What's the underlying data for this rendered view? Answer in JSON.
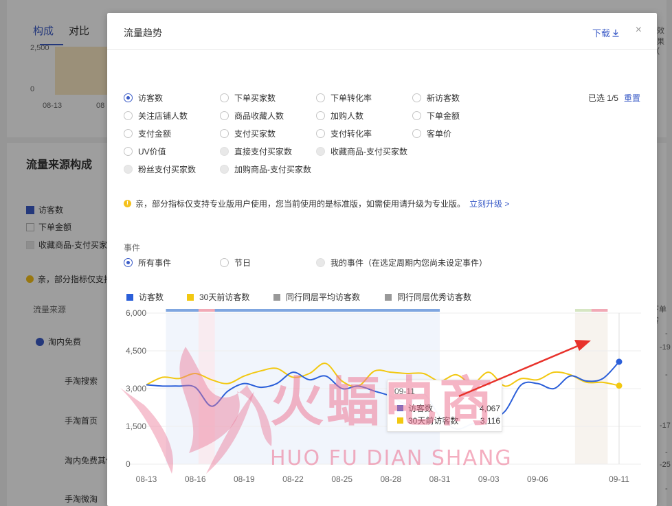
{
  "background": {
    "tabs": [
      "构成",
      "对比"
    ],
    "mini_chart": {
      "y_ticks": [
        "2,500",
        "0"
      ],
      "x_ticks": [
        "08-13",
        "08"
      ]
    },
    "top_right_text": "效果(",
    "section_title": "流量来源构成",
    "checks": [
      {
        "label": "访客数",
        "state": "on"
      },
      {
        "label": "下单金额",
        "state": "off"
      },
      {
        "label": "收藏商品-支付买家",
        "state": "dis"
      }
    ],
    "notice": "亲，部分指标仅支持",
    "table_header": "流量来源",
    "group": "淘内免费",
    "rows": [
      "手淘搜索",
      "手淘首页",
      "淘内免费其他",
      "手淘微淘"
    ],
    "right_header": "下单转",
    "right_values": [
      "-",
      "-19",
      "-",
      "-17",
      "-",
      "-25",
      "-"
    ]
  },
  "modal": {
    "title": "流量趋势",
    "download": "下载",
    "close": "×",
    "selected": "已选 1/5",
    "reset": "重置",
    "metrics": [
      [
        {
          "label": "访客数",
          "state": "checked"
        },
        {
          "label": "下单买家数",
          "state": "normal"
        },
        {
          "label": "下单转化率",
          "state": "normal"
        },
        {
          "label": "新访客数",
          "state": "normal"
        }
      ],
      [
        {
          "label": "关注店铺人数",
          "state": "normal"
        },
        {
          "label": "商品收藏人数",
          "state": "normal"
        },
        {
          "label": "加购人数",
          "state": "normal"
        },
        {
          "label": "下单金额",
          "state": "normal"
        }
      ],
      [
        {
          "label": "支付金额",
          "state": "normal"
        },
        {
          "label": "支付买家数",
          "state": "normal"
        },
        {
          "label": "支付转化率",
          "state": "normal"
        },
        {
          "label": "客单价",
          "state": "normal"
        }
      ],
      [
        {
          "label": "UV价值",
          "state": "normal"
        },
        {
          "label": "直接支付买家数",
          "state": "disabled"
        },
        {
          "label": "收藏商品-支付买家数",
          "state": "disabled"
        }
      ],
      [
        {
          "label": "粉丝支付买家数",
          "state": "disabled"
        },
        {
          "label": "加购商品-支付买家数",
          "state": "disabled"
        }
      ]
    ],
    "notice": {
      "text": "亲，部分指标仅支持专业版用户使用，您当前使用的是标准版，如需使用请升级为专业版。",
      "link": "立刻升级 >"
    },
    "event_label": "事件",
    "events": [
      {
        "label": "所有事件",
        "state": "checked"
      },
      {
        "label": "节日",
        "state": "normal"
      },
      {
        "label": "我的事件（在选定周期内您尚未设定事件）",
        "state": "disabled"
      }
    ],
    "legend": [
      {
        "label": "访客数",
        "color": "#2b5fd9"
      },
      {
        "label": "30天前访客数",
        "color": "#f2c811"
      },
      {
        "label": "同行同层平均访客数",
        "color": "#999999"
      },
      {
        "label": "同行同层优秀访客数",
        "color": "#999999"
      }
    ],
    "tooltip": {
      "date": "09-11",
      "rows": [
        {
          "name": "访客数",
          "value": "4,067",
          "color": "#2b5fd9"
        },
        {
          "name": "30天前访客数",
          "value": "3,116",
          "color": "#f2c811"
        }
      ]
    }
  },
  "chart_data": {
    "type": "line",
    "x": [
      "08-13",
      "08-14",
      "08-15",
      "08-16",
      "08-17",
      "08-18",
      "08-19",
      "08-20",
      "08-21",
      "08-22",
      "08-23",
      "08-24",
      "08-25",
      "08-26",
      "08-27",
      "08-28",
      "08-29",
      "08-30",
      "08-31",
      "09-01",
      "09-02",
      "09-03",
      "09-04",
      "09-05",
      "09-06",
      "09-07",
      "09-08",
      "09-09",
      "09-10",
      "09-11"
    ],
    "x_ticks": [
      "08-13",
      "08-16",
      "08-19",
      "08-22",
      "08-25",
      "08-28",
      "08-31",
      "09-03",
      "09-06",
      "09-11"
    ],
    "series": [
      {
        "name": "访客数",
        "color": "#2b5fd9",
        "values": [
          3150,
          3100,
          3100,
          3050,
          2300,
          2900,
          3200,
          3050,
          3200,
          3650,
          3350,
          3500,
          3000,
          3100,
          2900,
          2700,
          2400,
          2800,
          1900,
          1400,
          1600,
          1750,
          2100,
          3150,
          3200,
          3000,
          3500,
          3300,
          3400,
          4067
        ]
      },
      {
        "name": "30天前访客数",
        "color": "#f2c811",
        "values": [
          3150,
          3450,
          3400,
          3600,
          3350,
          3200,
          3500,
          3700,
          3800,
          3450,
          3600,
          4000,
          3300,
          3100,
          3700,
          3650,
          3600,
          3600,
          3300,
          3550,
          3200,
          3650,
          3100,
          3400,
          3350,
          3650,
          3550,
          3250,
          3250,
          3116
        ]
      }
    ],
    "y_ticks": [
      "6,000",
      "4,500",
      "3,000",
      "1,500",
      "0"
    ],
    "ylim": [
      0,
      6000
    ]
  }
}
